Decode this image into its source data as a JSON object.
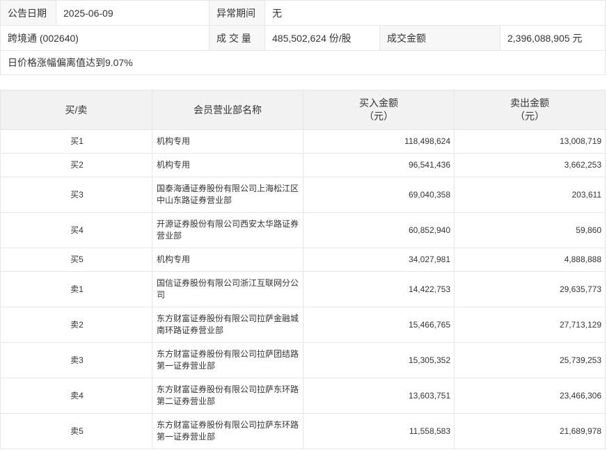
{
  "announcement": {
    "date_label": "公告日期",
    "date_value": "2025-06-09",
    "period_label": "异常期间",
    "period_value": "无",
    "stock": "跨境通 (002640)",
    "volume_label": "成 交 量",
    "volume_value": "485,502,624 份/股",
    "amount_label": "成交金额",
    "amount_value": "2,396,088,905 元",
    "reason": "日价格涨幅偏离值达到9.07%"
  },
  "trades": {
    "headers": {
      "side": "买/卖",
      "name": "会员营业部名称",
      "buy": "买入金额",
      "buy_unit": "（元）",
      "sell": "卖出金额",
      "sell_unit": "（元）"
    },
    "rows": [
      {
        "side": "买1",
        "name": "机构专用",
        "buy": "118,498,624",
        "sell": "13,008,719"
      },
      {
        "side": "买2",
        "name": "机构专用",
        "buy": "96,541,436",
        "sell": "3,662,253"
      },
      {
        "side": "买3",
        "name": "国泰海通证券股份有限公司上海松江区中山东路证券营业部",
        "buy": "69,040,358",
        "sell": "203,611"
      },
      {
        "side": "买4",
        "name": "开源证券股份有限公司西安太华路证券营业部",
        "buy": "60,852,940",
        "sell": "59,860"
      },
      {
        "side": "买5",
        "name": "机构专用",
        "buy": "34,027,981",
        "sell": "4,888,888"
      },
      {
        "side": "卖1",
        "name": "国信证券股份有限公司浙江互联网分公司",
        "buy": "14,422,753",
        "sell": "29,635,773"
      },
      {
        "side": "卖2",
        "name": "东方财富证券股份有限公司拉萨金融城南环路证券营业部",
        "buy": "15,466,765",
        "sell": "27,713,129"
      },
      {
        "side": "卖3",
        "name": "东方财富证券股份有限公司拉萨团结路第一证券营业部",
        "buy": "15,305,352",
        "sell": "25,739,253"
      },
      {
        "side": "卖4",
        "name": "东方财富证券股份有限公司拉萨东环路第二证券营业部",
        "buy": "13,603,751",
        "sell": "23,466,306"
      },
      {
        "side": "卖5",
        "name": "东方财富证券股份有限公司拉萨东环路第一证券营业部",
        "buy": "11,558,583",
        "sell": "21,689,978"
      }
    ]
  }
}
